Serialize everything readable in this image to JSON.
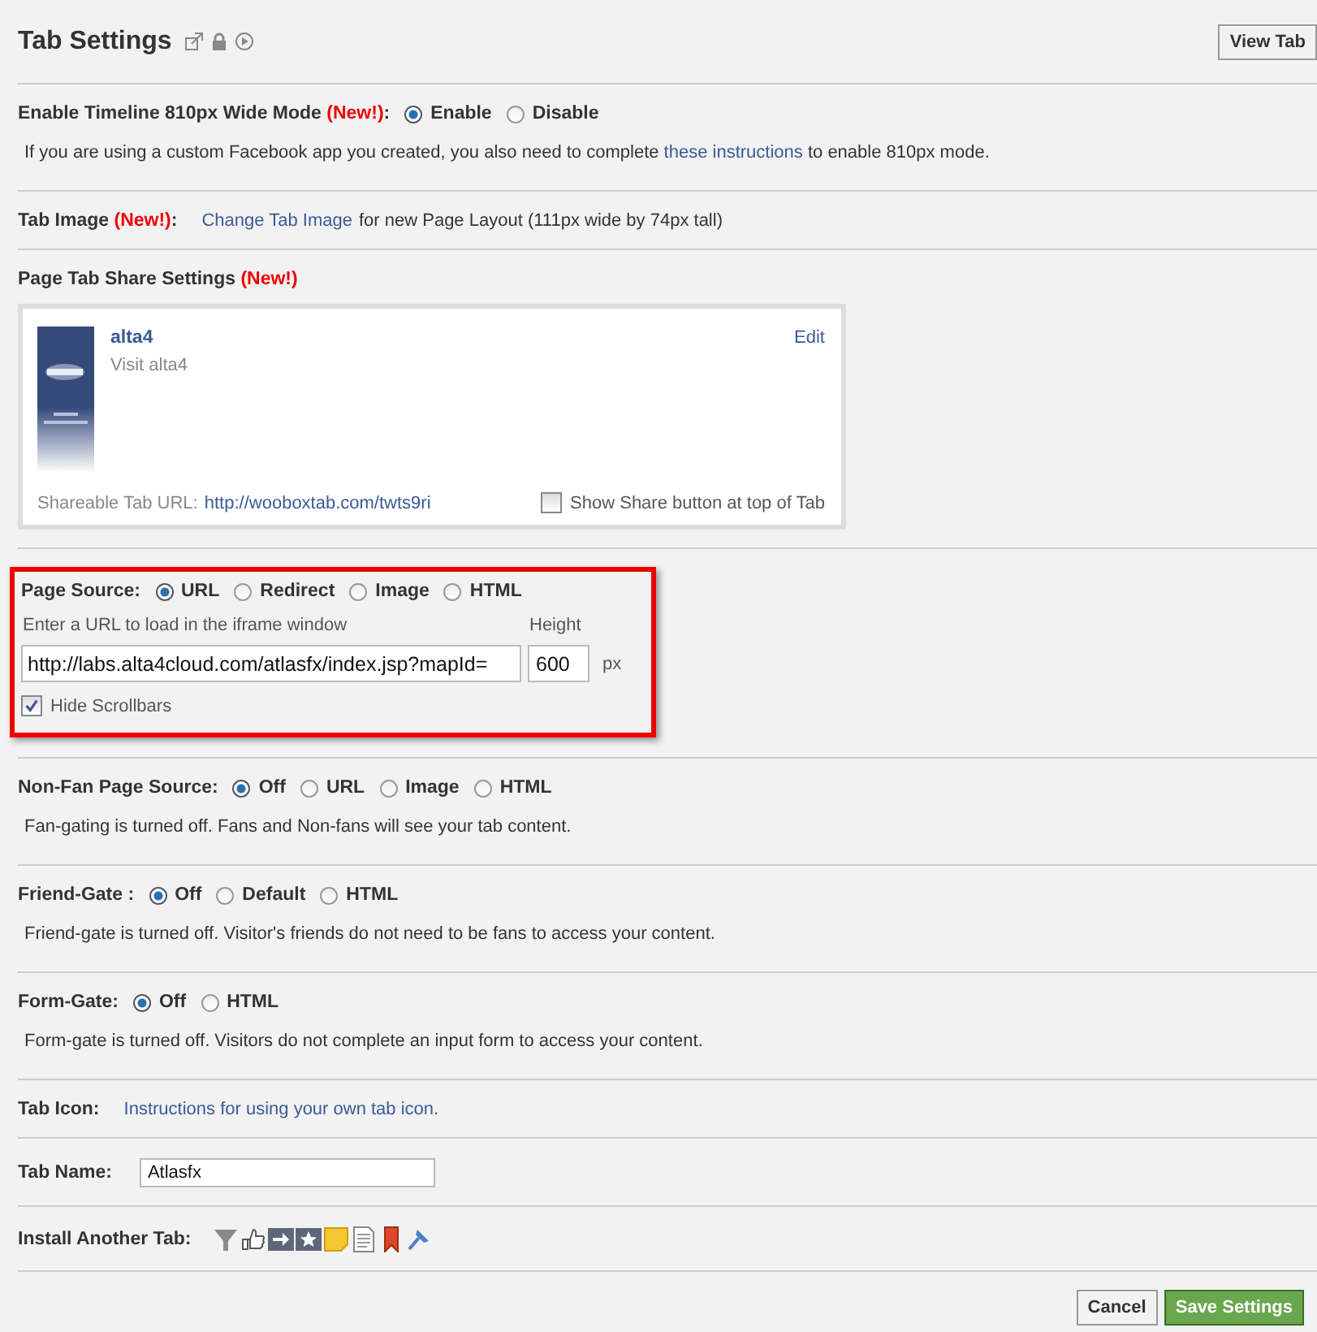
{
  "header": {
    "title": "Tab Settings",
    "view_button": "View Tab"
  },
  "sections": [
    {
      "kind": "radio",
      "label": "Enable Timeline 810px Wide Mode",
      "badge": "(New!)",
      "suffix": ":",
      "options": [
        {
          "label": "Enable",
          "selected": true
        },
        {
          "label": "Disable",
          "selected": false
        }
      ],
      "note": [
        {
          "text": "If you are using a custom Facebook app you created, you also need to complete ",
          "link": false
        },
        {
          "text": "these instructions",
          "link": true
        },
        {
          "text": " to enable 810px mode.",
          "link": false
        }
      ]
    },
    {
      "kind": "line",
      "label": "Tab Image",
      "badge": "(New!)",
      "suffix": ":",
      "parts": [
        {
          "text": "Change Tab Image",
          "link": true
        },
        {
          "text": " for new Page Layout (111px wide by 74px tall)",
          "link": false
        }
      ]
    },
    {
      "kind": "share",
      "label": "Page Tab Share Settings",
      "badge": "(New!)",
      "card": {
        "title": "alta4",
        "subtitle": "Visit alta4",
        "edit": "Edit",
        "url_label": "Shareable Tab URL:",
        "url": "http://wooboxtab.com/twts9ri",
        "checkbox": {
          "label": "Show Share button at top of Tab",
          "checked": false
        }
      }
    },
    {
      "kind": "source",
      "highlighted": true,
      "label": "Page Source:",
      "options": [
        {
          "label": "URL",
          "selected": true
        },
        {
          "label": "Redirect",
          "selected": false
        },
        {
          "label": "Image",
          "selected": false
        },
        {
          "label": "HTML",
          "selected": false
        }
      ],
      "url_hint": "Enter a URL to load in the iframe window",
      "url_value": "http://labs.alta4cloud.com/atlasfx/index.jsp?mapId=",
      "height_label": "Height",
      "height_value": "600",
      "unit": "px",
      "checkbox": {
        "label": "Hide Scrollbars",
        "checked": true
      }
    },
    {
      "kind": "radio",
      "label": "Non-Fan Page Source:",
      "options": [
        {
          "label": "Off",
          "selected": true
        },
        {
          "label": "URL",
          "selected": false
        },
        {
          "label": "Image",
          "selected": false
        },
        {
          "label": "HTML",
          "selected": false
        }
      ],
      "note": [
        {
          "text": "Fan-gating is turned off. Fans and Non-fans will see your tab content.",
          "link": false
        }
      ]
    },
    {
      "kind": "radio",
      "label": "Friend-Gate :",
      "options": [
        {
          "label": "Off",
          "selected": true
        },
        {
          "label": "Default",
          "selected": false
        },
        {
          "label": "HTML",
          "selected": false
        }
      ],
      "note": [
        {
          "text": "Friend-gate is turned off. Visitor's friends do not need to be fans to access your content.",
          "link": false
        }
      ]
    },
    {
      "kind": "radio",
      "label": "Form-Gate:",
      "options": [
        {
          "label": "Off",
          "selected": true
        },
        {
          "label": "HTML",
          "selected": false
        }
      ],
      "note": [
        {
          "text": "Form-gate is turned off. Visitors do not complete an input form to access your content.",
          "link": false
        }
      ]
    },
    {
      "kind": "line",
      "label": "Tab Icon:",
      "parts": [
        {
          "text": "Instructions for using your own tab icon.",
          "link": true
        }
      ]
    },
    {
      "kind": "name",
      "label": "Tab Name:",
      "value": "Atlasfx"
    },
    {
      "kind": "install",
      "label": "Install Another Tab:"
    }
  ],
  "buttons": [
    {
      "label": "Cancel",
      "kind": "plain"
    },
    {
      "label": "Save Settings",
      "kind": "primary"
    }
  ]
}
